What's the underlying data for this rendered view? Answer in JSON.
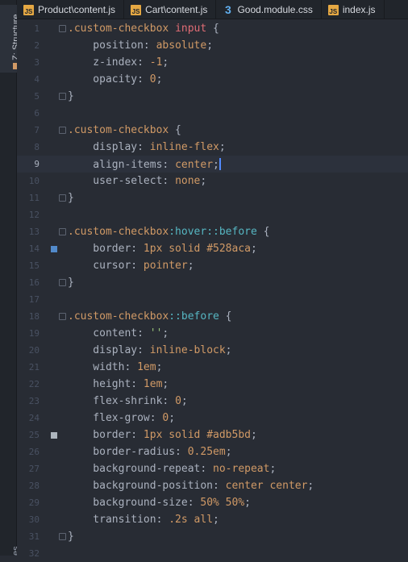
{
  "sidebar": {
    "structure_label": "Z: Structure",
    "bottom_label": "es"
  },
  "tabs": [
    {
      "label": "Product\\content.js",
      "icon": "js"
    },
    {
      "label": "Cart\\content.js",
      "icon": "js"
    },
    {
      "label": "Good.module.css",
      "icon": "css"
    },
    {
      "label": "index.js",
      "icon": "js"
    }
  ],
  "editor": {
    "current_line": 9,
    "lines": [
      {
        "n": "1",
        "tokens": [
          [
            "sel",
            ".custom-checkbox "
          ],
          [
            "tag",
            "input"
          ],
          [
            "brace",
            " {"
          ]
        ]
      },
      {
        "n": "2",
        "tokens": [
          [
            "prop",
            "    position: "
          ],
          [
            "val",
            "absolute"
          ],
          [
            "brace",
            ";"
          ]
        ]
      },
      {
        "n": "3",
        "tokens": [
          [
            "prop",
            "    z-index: "
          ],
          [
            "num",
            "-1"
          ],
          [
            "brace",
            ";"
          ]
        ]
      },
      {
        "n": "4",
        "tokens": [
          [
            "prop",
            "    opacity: "
          ],
          [
            "num",
            "0"
          ],
          [
            "brace",
            ";"
          ]
        ]
      },
      {
        "n": "5",
        "tokens": [
          [
            "brace",
            "}"
          ]
        ]
      },
      {
        "n": "6",
        "tokens": []
      },
      {
        "n": "7",
        "tokens": [
          [
            "sel",
            ".custom-checkbox"
          ],
          [
            "brace",
            " {"
          ]
        ]
      },
      {
        "n": "8",
        "tokens": [
          [
            "prop",
            "    display: "
          ],
          [
            "val",
            "inline-flex"
          ],
          [
            "brace",
            ";"
          ]
        ]
      },
      {
        "n": "9",
        "tokens": [
          [
            "prop",
            "    align-items: "
          ],
          [
            "val",
            "center"
          ],
          [
            "brace",
            ";"
          ]
        ]
      },
      {
        "n": "10",
        "tokens": [
          [
            "prop",
            "    user-select: "
          ],
          [
            "val",
            "none"
          ],
          [
            "brace",
            ";"
          ]
        ]
      },
      {
        "n": "11",
        "tokens": [
          [
            "brace",
            "}"
          ]
        ]
      },
      {
        "n": "12",
        "tokens": []
      },
      {
        "n": "13",
        "tokens": [
          [
            "sel",
            ".custom-checkbox"
          ],
          [
            "pseudo",
            ":hover::before"
          ],
          [
            "brace",
            " {"
          ]
        ]
      },
      {
        "n": "14",
        "tokens": [
          [
            "prop",
            "    border: "
          ],
          [
            "num",
            "1px "
          ],
          [
            "val",
            "solid "
          ],
          [
            "num",
            "#528aca"
          ],
          [
            "brace",
            ";"
          ]
        ],
        "swatch": "#528aca"
      },
      {
        "n": "15",
        "tokens": [
          [
            "prop",
            "    cursor: "
          ],
          [
            "val",
            "pointer"
          ],
          [
            "brace",
            ";"
          ]
        ]
      },
      {
        "n": "16",
        "tokens": [
          [
            "brace",
            "}"
          ]
        ]
      },
      {
        "n": "17",
        "tokens": []
      },
      {
        "n": "18",
        "tokens": [
          [
            "sel",
            ".custom-checkbox"
          ],
          [
            "pseudo",
            "::before"
          ],
          [
            "brace",
            " {"
          ]
        ]
      },
      {
        "n": "19",
        "tokens": [
          [
            "prop",
            "    content: "
          ],
          [
            "str",
            "''"
          ],
          [
            "brace",
            ";"
          ]
        ]
      },
      {
        "n": "20",
        "tokens": [
          [
            "prop",
            "    display: "
          ],
          [
            "val",
            "inline-block"
          ],
          [
            "brace",
            ";"
          ]
        ]
      },
      {
        "n": "21",
        "tokens": [
          [
            "prop",
            "    width: "
          ],
          [
            "num",
            "1em"
          ],
          [
            "brace",
            ";"
          ]
        ]
      },
      {
        "n": "22",
        "tokens": [
          [
            "prop",
            "    height: "
          ],
          [
            "num",
            "1em"
          ],
          [
            "brace",
            ";"
          ]
        ]
      },
      {
        "n": "23",
        "tokens": [
          [
            "prop",
            "    flex-shrink: "
          ],
          [
            "num",
            "0"
          ],
          [
            "brace",
            ";"
          ]
        ]
      },
      {
        "n": "24",
        "tokens": [
          [
            "prop",
            "    flex-grow: "
          ],
          [
            "num",
            "0"
          ],
          [
            "brace",
            ";"
          ]
        ]
      },
      {
        "n": "25",
        "tokens": [
          [
            "prop",
            "    border: "
          ],
          [
            "num",
            "1px "
          ],
          [
            "val",
            "solid "
          ],
          [
            "num",
            "#adb5bd"
          ],
          [
            "brace",
            ";"
          ]
        ],
        "swatch": "#adb5bd"
      },
      {
        "n": "26",
        "tokens": [
          [
            "prop",
            "    border-radius: "
          ],
          [
            "num",
            "0.25em"
          ],
          [
            "brace",
            ";"
          ]
        ]
      },
      {
        "n": "27",
        "tokens": [
          [
            "prop",
            "    background-repeat: "
          ],
          [
            "val",
            "no-repeat"
          ],
          [
            "brace",
            ";"
          ]
        ]
      },
      {
        "n": "28",
        "tokens": [
          [
            "prop",
            "    background-position: "
          ],
          [
            "val",
            "center center"
          ],
          [
            "brace",
            ";"
          ]
        ]
      },
      {
        "n": "29",
        "tokens": [
          [
            "prop",
            "    background-size: "
          ],
          [
            "num",
            "50% 50%"
          ],
          [
            "brace",
            ";"
          ]
        ]
      },
      {
        "n": "30",
        "tokens": [
          [
            "prop",
            "    transition: "
          ],
          [
            "num",
            ".2s "
          ],
          [
            "val",
            "all"
          ],
          [
            "brace",
            ";"
          ]
        ]
      },
      {
        "n": "31",
        "tokens": [
          [
            "brace",
            "}"
          ]
        ]
      },
      {
        "n": "32",
        "tokens": []
      }
    ]
  }
}
